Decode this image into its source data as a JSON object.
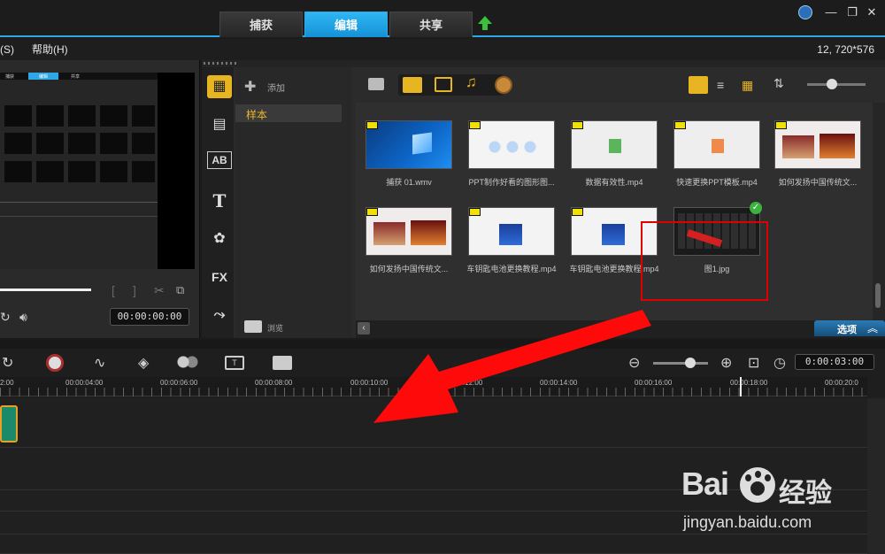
{
  "tabs": [
    {
      "label": "捕获",
      "active": false
    },
    {
      "label": "编辑",
      "active": true
    },
    {
      "label": "共享",
      "active": false
    }
  ],
  "menu": {
    "items": [
      "(S)",
      "帮助(H)"
    ],
    "resolution": "12, 720*576"
  },
  "preview": {
    "timecode": "00:00:00:00",
    "mini_tabs": [
      "捕获",
      "编辑",
      "共享"
    ]
  },
  "library": {
    "add_label": "添加",
    "folder": "样本",
    "browse_label": "浏览",
    "options_label": "选项",
    "thumbnails": [
      {
        "caption": "捕获 01.wmv",
        "kind": "win"
      },
      {
        "caption": "PPT制作好看的图形图...",
        "kind": "circles"
      },
      {
        "caption": "数据有效性.mp4",
        "kind": "excel"
      },
      {
        "caption": "快速更换PPT模板.mp4",
        "kind": "ppt"
      },
      {
        "caption": "如何发扬中国传统文...",
        "kind": "opera"
      },
      {
        "caption": "如何发扬中国传统文...",
        "kind": "opera"
      },
      {
        "caption": "车钥匙电池更换教程.mp4",
        "kind": "key"
      },
      {
        "caption": "车钥匙电池更换教程.mp4",
        "kind": "key"
      },
      {
        "caption": "图1.jpg",
        "kind": "screen"
      }
    ]
  },
  "timeline": {
    "timecode": "0:00:03:00",
    "ruler": [
      "2:00",
      "00:00:04:00",
      "00:00:06:00",
      "00:00:08:00",
      "00:00:10:00",
      "00:00:12:00",
      "00:00:14:00",
      "00:00:16:00",
      "00:00:18:00",
      "00:00:20:0"
    ]
  },
  "watermark": {
    "brand": "Bai",
    "suffix": "经验",
    "url": "jingyan.baidu.com"
  },
  "colors": {
    "accent": "#2fa7e6",
    "annotation": "#e00000",
    "badge": "#f2e100"
  }
}
